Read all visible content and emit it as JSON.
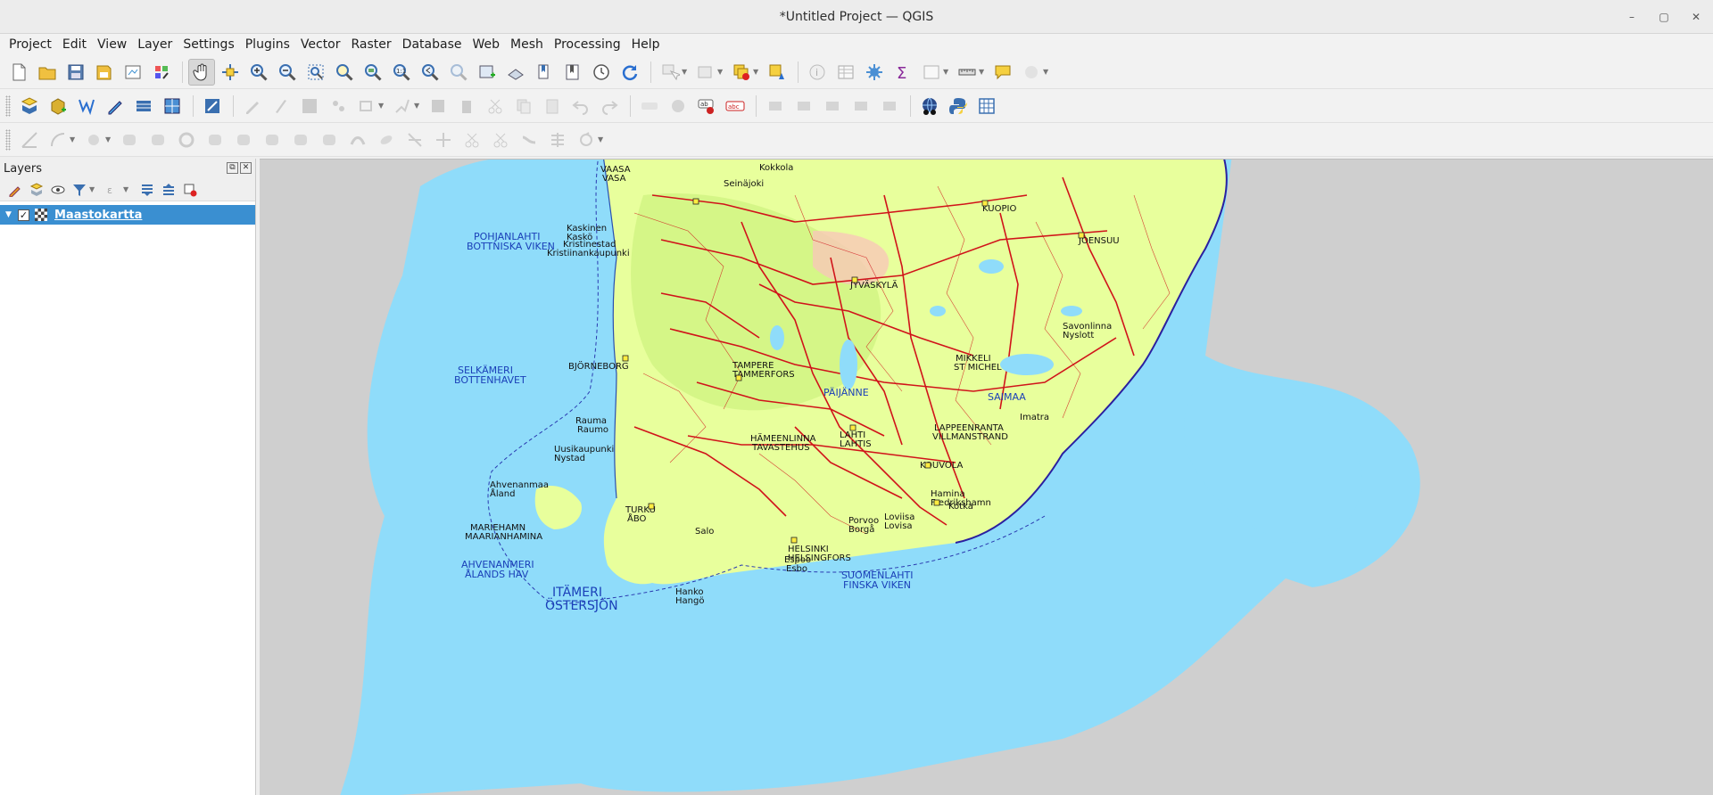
{
  "window": {
    "title": "*Untitled Project — QGIS"
  },
  "menu": [
    "Project",
    "Edit",
    "View",
    "Layer",
    "Settings",
    "Plugins",
    "Vector",
    "Raster",
    "Database",
    "Web",
    "Mesh",
    "Processing",
    "Help"
  ],
  "layers_panel": {
    "title": "Layers",
    "layers": [
      {
        "name": "Maastokartta",
        "visible": true,
        "expanded": true
      }
    ]
  },
  "map": {
    "cities": [
      {
        "name": "VAASA",
        "sub": "VASA"
      },
      {
        "name": "KUOPIO"
      },
      {
        "name": "JOENSUU"
      },
      {
        "name": "JYVÄSKYLÄ"
      },
      {
        "name": "BJÖRNEBORG"
      },
      {
        "name": "TAMPERE",
        "sub": "TAMMERFORS"
      },
      {
        "name": "MIKKELI",
        "sub": "ST MICHEL"
      },
      {
        "name": "LAHTI",
        "sub": "LAHTIS"
      },
      {
        "name": "HÄMEENLINNA",
        "sub": "TAVASTEHUS"
      },
      {
        "name": "LAPPEENRANTA",
        "sub": "VILLMANSTRAND"
      },
      {
        "name": "KOUVOLA"
      },
      {
        "name": "TURKU",
        "sub": "ÅBO"
      },
      {
        "name": "HELSINKI",
        "sub": "HELSINGFORS"
      },
      {
        "name": "MARIEHAMN",
        "sub": "MAARIANHAMINA"
      },
      {
        "name": "Kotka"
      },
      {
        "name": "Porvoo",
        "sub": "Borgå"
      },
      {
        "name": "Espoo",
        "sub": "Esbo"
      },
      {
        "name": "Hanko",
        "sub": "Hangö"
      },
      {
        "name": "Salo"
      },
      {
        "name": "Rauma",
        "sub": "Raumo"
      },
      {
        "name": "Seinäjoki"
      },
      {
        "name": "Kokkola"
      },
      {
        "name": "Savonlinna",
        "sub": "Nyslott"
      },
      {
        "name": "Imatra"
      },
      {
        "name": "Hamina",
        "sub": "Fredrikshamn"
      },
      {
        "name": "Loviisa",
        "sub": "Lovisa"
      },
      {
        "name": "Ahvenanmaa",
        "sub": "Åland"
      },
      {
        "name": "Kristinestad",
        "sub": "Kristiinankaupunki"
      },
      {
        "name": "Kaskinen",
        "sub": "Kaskö"
      },
      {
        "name": "Uusikaupunki",
        "sub": "Nystad"
      }
    ],
    "seas": [
      {
        "name": "POHJANLAHTI",
        "sub": "BOTTNISKA VIKEN"
      },
      {
        "name": "SELKÄMERI",
        "sub": "BOTTENHAVET"
      },
      {
        "name": "AHVENANMERI",
        "sub": "ÅLANDS HAV"
      },
      {
        "name": "ITÄMERI",
        "sub": "ÖSTERSJÖN"
      },
      {
        "name": "SUOMENLAHTI",
        "sub": "FINSKA VIKEN"
      }
    ],
    "lakes": [
      "PÄIJÄNNE",
      "SAIMAA"
    ]
  }
}
